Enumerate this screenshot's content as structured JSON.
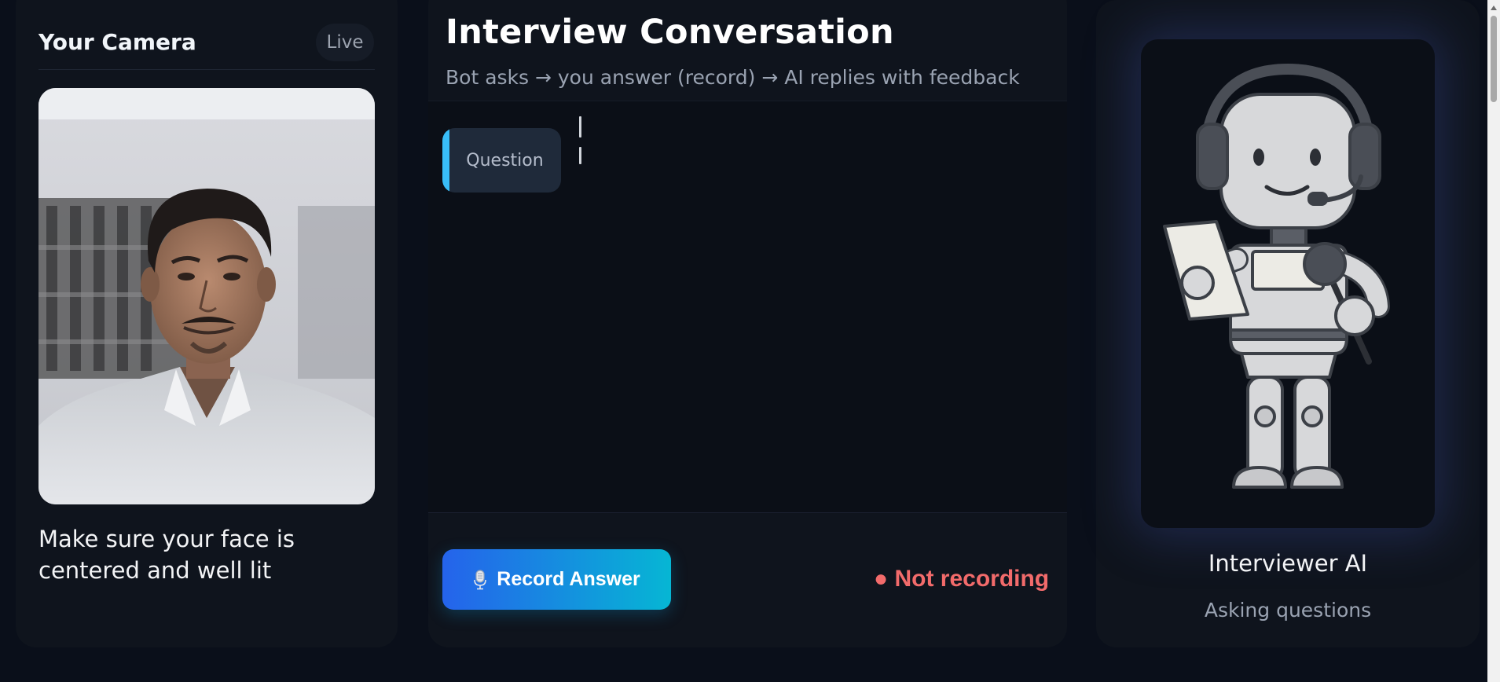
{
  "camera_panel": {
    "title": "Your Camera",
    "badge": "Live",
    "hint": "Make sure your face is centered and well lit"
  },
  "conversation": {
    "title": "Interview Conversation",
    "subtitle": "Bot asks → you answer (record) → AI replies with feedback",
    "question_label": "Question",
    "record_button_label": "Record Answer",
    "record_button_icon": "microphone-icon",
    "status": "● Not recording",
    "status_color": "#f26b6b"
  },
  "interviewer": {
    "name": "Interviewer AI",
    "status": "Asking questions"
  },
  "colors": {
    "background": "#0a0f1a",
    "panel": "#0f141d",
    "accent": "#38bdf8",
    "button_gradient_start": "#2563eb",
    "button_gradient_end": "#06b6d4"
  }
}
